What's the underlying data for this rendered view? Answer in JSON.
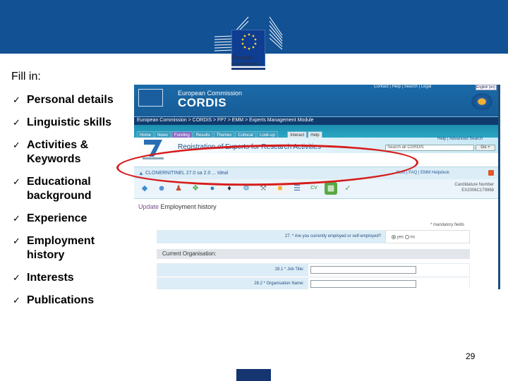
{
  "header": {
    "logo_line1": "European",
    "logo_line2": "Commission",
    "brand_color": "#125194"
  },
  "slide": {
    "fill_title": "Fill in:",
    "checklist": [
      "Personal details",
      "Linguistic skills",
      "Activities & Keywords",
      "Educational background",
      "Experience",
      "Employment history",
      "Interests",
      "Publications"
    ],
    "check_glyph": "✓",
    "page_number": "29"
  },
  "cordis": {
    "org": "European Commission",
    "site": "CORDIS",
    "top_links": "Contact | Help | Search | Legal",
    "language": "English (en)",
    "breadcrumb": "European Commission > CORDIS > FP7 > EMM > Experts Management Module",
    "nav_tabs": [
      "Home",
      "News",
      "Funding",
      "Results",
      "Themes",
      "Collocat",
      "Look-up",
      "Interact",
      "Help"
    ],
    "page_title": "Registration of Experts for Research Activities",
    "help_links": "Help | Advanced Search",
    "search_placeholder": "Search all CORDIS",
    "go_label": "Go",
    "user_name": "CLONERNITINEL 27.0 sa 2.0 ... Ideal",
    "user_links": "Next | FAQ | EMM Helpdesk",
    "candidature_label": "Candidature Number",
    "candidature_number": "EX2006C179968",
    "section_title_prefix": "Update",
    "section_title": "Employment history",
    "mandatory_note": "* mandatory fields",
    "question": "27. * Are you currently employed or self-employed?",
    "answer_yes": "yes",
    "answer_no": "no",
    "current_org": "Current Organisation:",
    "fields": [
      {
        "label": "28.1 * Job Title:",
        "value": ""
      },
      {
        "label": "28.2 * Organisation Name:",
        "value": ""
      }
    ]
  }
}
